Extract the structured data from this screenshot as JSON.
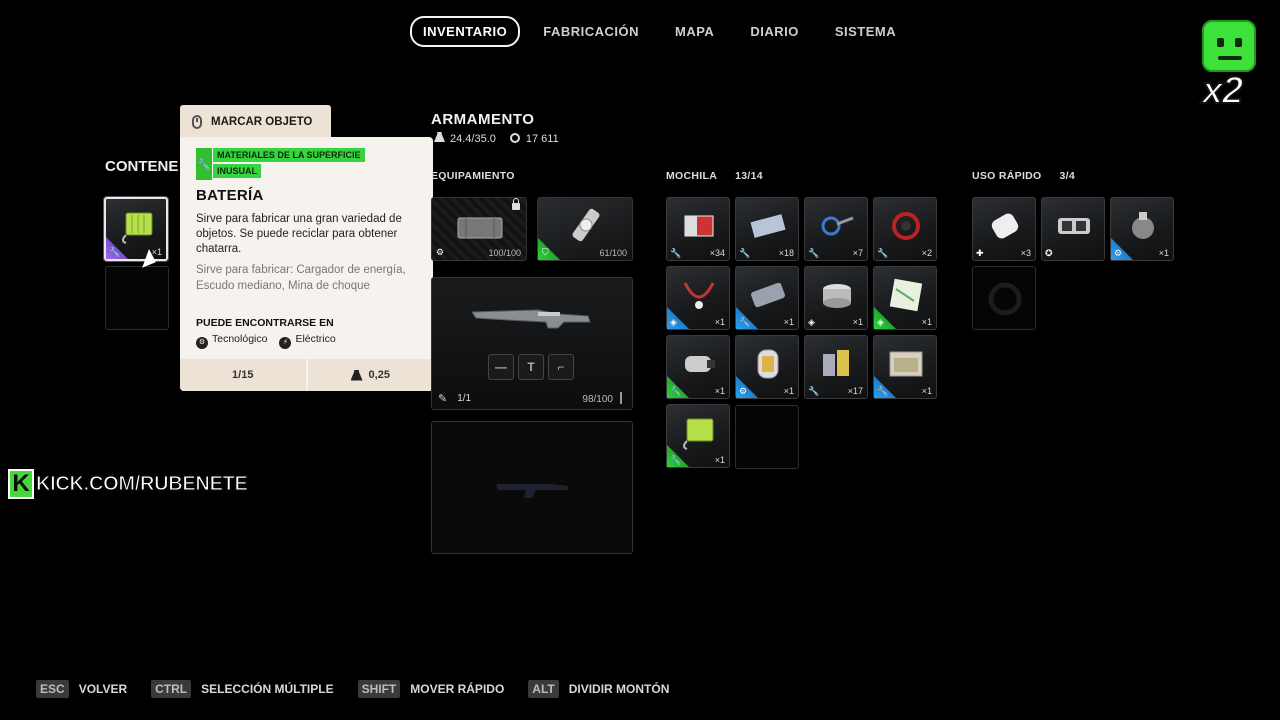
{
  "nav": {
    "tabs": [
      {
        "label": "INVENTARIO",
        "active": true
      },
      {
        "label": "FABRICACIÓN",
        "active": false
      },
      {
        "label": "MAPA",
        "active": false
      },
      {
        "label": "DIARIO",
        "active": false
      },
      {
        "label": "SISTEMA",
        "active": false
      }
    ]
  },
  "mascot": {
    "multiplier": "x2",
    "color": "#3ee03a"
  },
  "container": {
    "title": "CONTENEDOR",
    "title_visible": "CONTENE",
    "slot_qty": "×1"
  },
  "tooltip": {
    "header_label": "MARCAR OBJETO",
    "category_tag": "MATERIALES DE LA SUPERFICIE",
    "rarity_tag": "INUSUAL",
    "item_name": "BATERÍA",
    "description": "Sirve para fabricar una gran variedad de objetos. Se puede reciclar para obtener chatarra.",
    "crafting": "Sirve para fabricar: Cargador de energía, Escudo mediano, Mina de choque",
    "found_label": "PUEDE ENCONTRARSE EN",
    "locations": [
      "Tecnológico",
      "Eléctrico"
    ],
    "stack": "1/15",
    "weight": "0,25",
    "rarity_color": "#36d43e"
  },
  "armament": {
    "title": "ARMAMENTO",
    "weight": "24.4/35.0",
    "coins": "17 611",
    "equipment_label": "EQUIPAMIENTO",
    "equip_slots": [
      {
        "value": "100/100",
        "icon": "ammo-icon"
      },
      {
        "value": "61/100",
        "icon": "shield-icon"
      }
    ],
    "weapon1": {
      "ammo": "1/1",
      "durability": "98/100",
      "mods": [
        "—",
        "T",
        "⌐"
      ]
    },
    "weapon2": {
      "empty": true
    }
  },
  "backpack": {
    "label": "MOCHILA",
    "count": "13/14",
    "items": [
      {
        "qty": "×34",
        "rarity": "none",
        "icon": "wrench"
      },
      {
        "qty": "×18",
        "rarity": "none",
        "icon": "wrench"
      },
      {
        "qty": "×7",
        "rarity": "none",
        "icon": "wrench"
      },
      {
        "qty": "×2",
        "rarity": "none",
        "icon": "wrench"
      },
      {
        "qty": "×1",
        "rarity": "blue",
        "icon": "gem"
      },
      {
        "qty": "×1",
        "rarity": "blue",
        "icon": "wrench"
      },
      {
        "qty": "×1",
        "rarity": "none",
        "icon": "gem"
      },
      {
        "qty": "×1",
        "rarity": "green",
        "icon": "gem"
      },
      {
        "qty": "×1",
        "rarity": "green",
        "icon": "wrench"
      },
      {
        "qty": "×1",
        "rarity": "blue",
        "icon": "ammo"
      },
      {
        "qty": "×17",
        "rarity": "none",
        "icon": "wrench"
      },
      {
        "qty": "×1",
        "rarity": "blue",
        "icon": "wrench"
      },
      {
        "qty": "×1",
        "rarity": "green",
        "icon": "wrench"
      }
    ]
  },
  "quick_use": {
    "label": "USO RÁPIDO",
    "count": "3/4",
    "items": [
      {
        "qty": "×3",
        "rarity": "none",
        "icon": "plus"
      },
      {
        "qty": "",
        "rarity": "none",
        "icon": "gear"
      },
      {
        "qty": "×1",
        "rarity": "blue",
        "icon": "ammo"
      }
    ]
  },
  "stream": {
    "url": "KICK.COM/RUBENETE",
    "logo_letter": "K"
  },
  "hints": [
    {
      "key": "ESC",
      "label": "VOLVER"
    },
    {
      "key": "CTRL",
      "label": "SELECCIÓN MÚLTIPLE"
    },
    {
      "key": "SHIFT",
      "label": "MOVER RÁPIDO"
    },
    {
      "key": "ALT",
      "label": "DIVIDIR MONTÓN"
    }
  ]
}
